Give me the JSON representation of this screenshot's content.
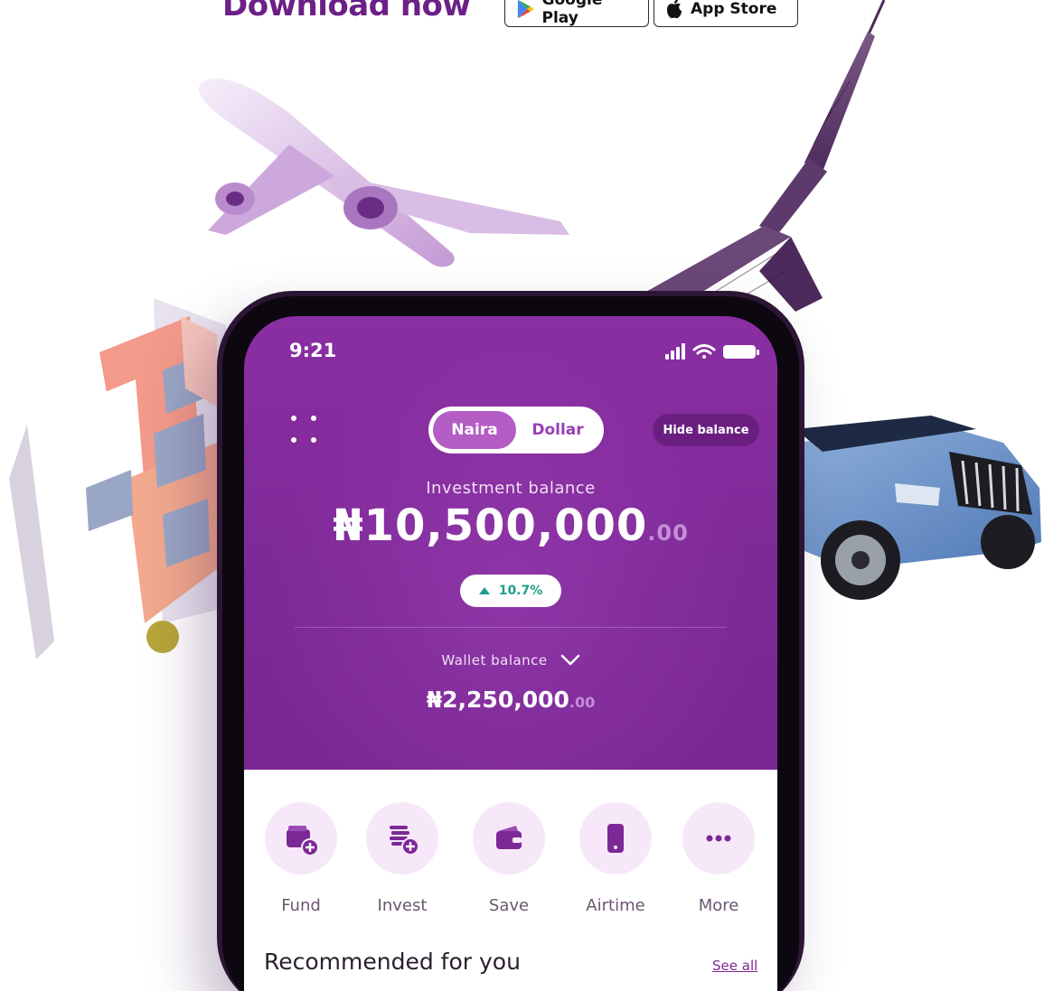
{
  "promo": {
    "download_label": "Download now",
    "google_play_label": "Google Play",
    "app_store_label": "App Store"
  },
  "status_bar": {
    "time": "9:21"
  },
  "currency_toggle": {
    "naira_label": "Naira",
    "dollar_label": "Dollar",
    "selected": "Naira"
  },
  "hide_balance_label": "Hide balance",
  "investment": {
    "label": "Investment balance",
    "amount": "₦10,500,000",
    "cents": ".00",
    "change": "10.7%"
  },
  "wallet": {
    "label": "Wallet balance",
    "amount": "₦2,250,000",
    "cents": ".00"
  },
  "actions": [
    {
      "label": "Fund",
      "icon": "fund-wallet-icon"
    },
    {
      "label": "Invest",
      "icon": "invest-coins-icon"
    },
    {
      "label": "Save",
      "icon": "save-wallet-icon"
    },
    {
      "label": "Airtime",
      "icon": "phone-icon"
    },
    {
      "label": "More",
      "icon": "more-dots-icon"
    }
  ],
  "recommended": {
    "title": "Recommended for you",
    "see_all": "See all"
  },
  "colors": {
    "brand_purple": "#7c2896",
    "accent_teal": "#1f9e8a"
  }
}
